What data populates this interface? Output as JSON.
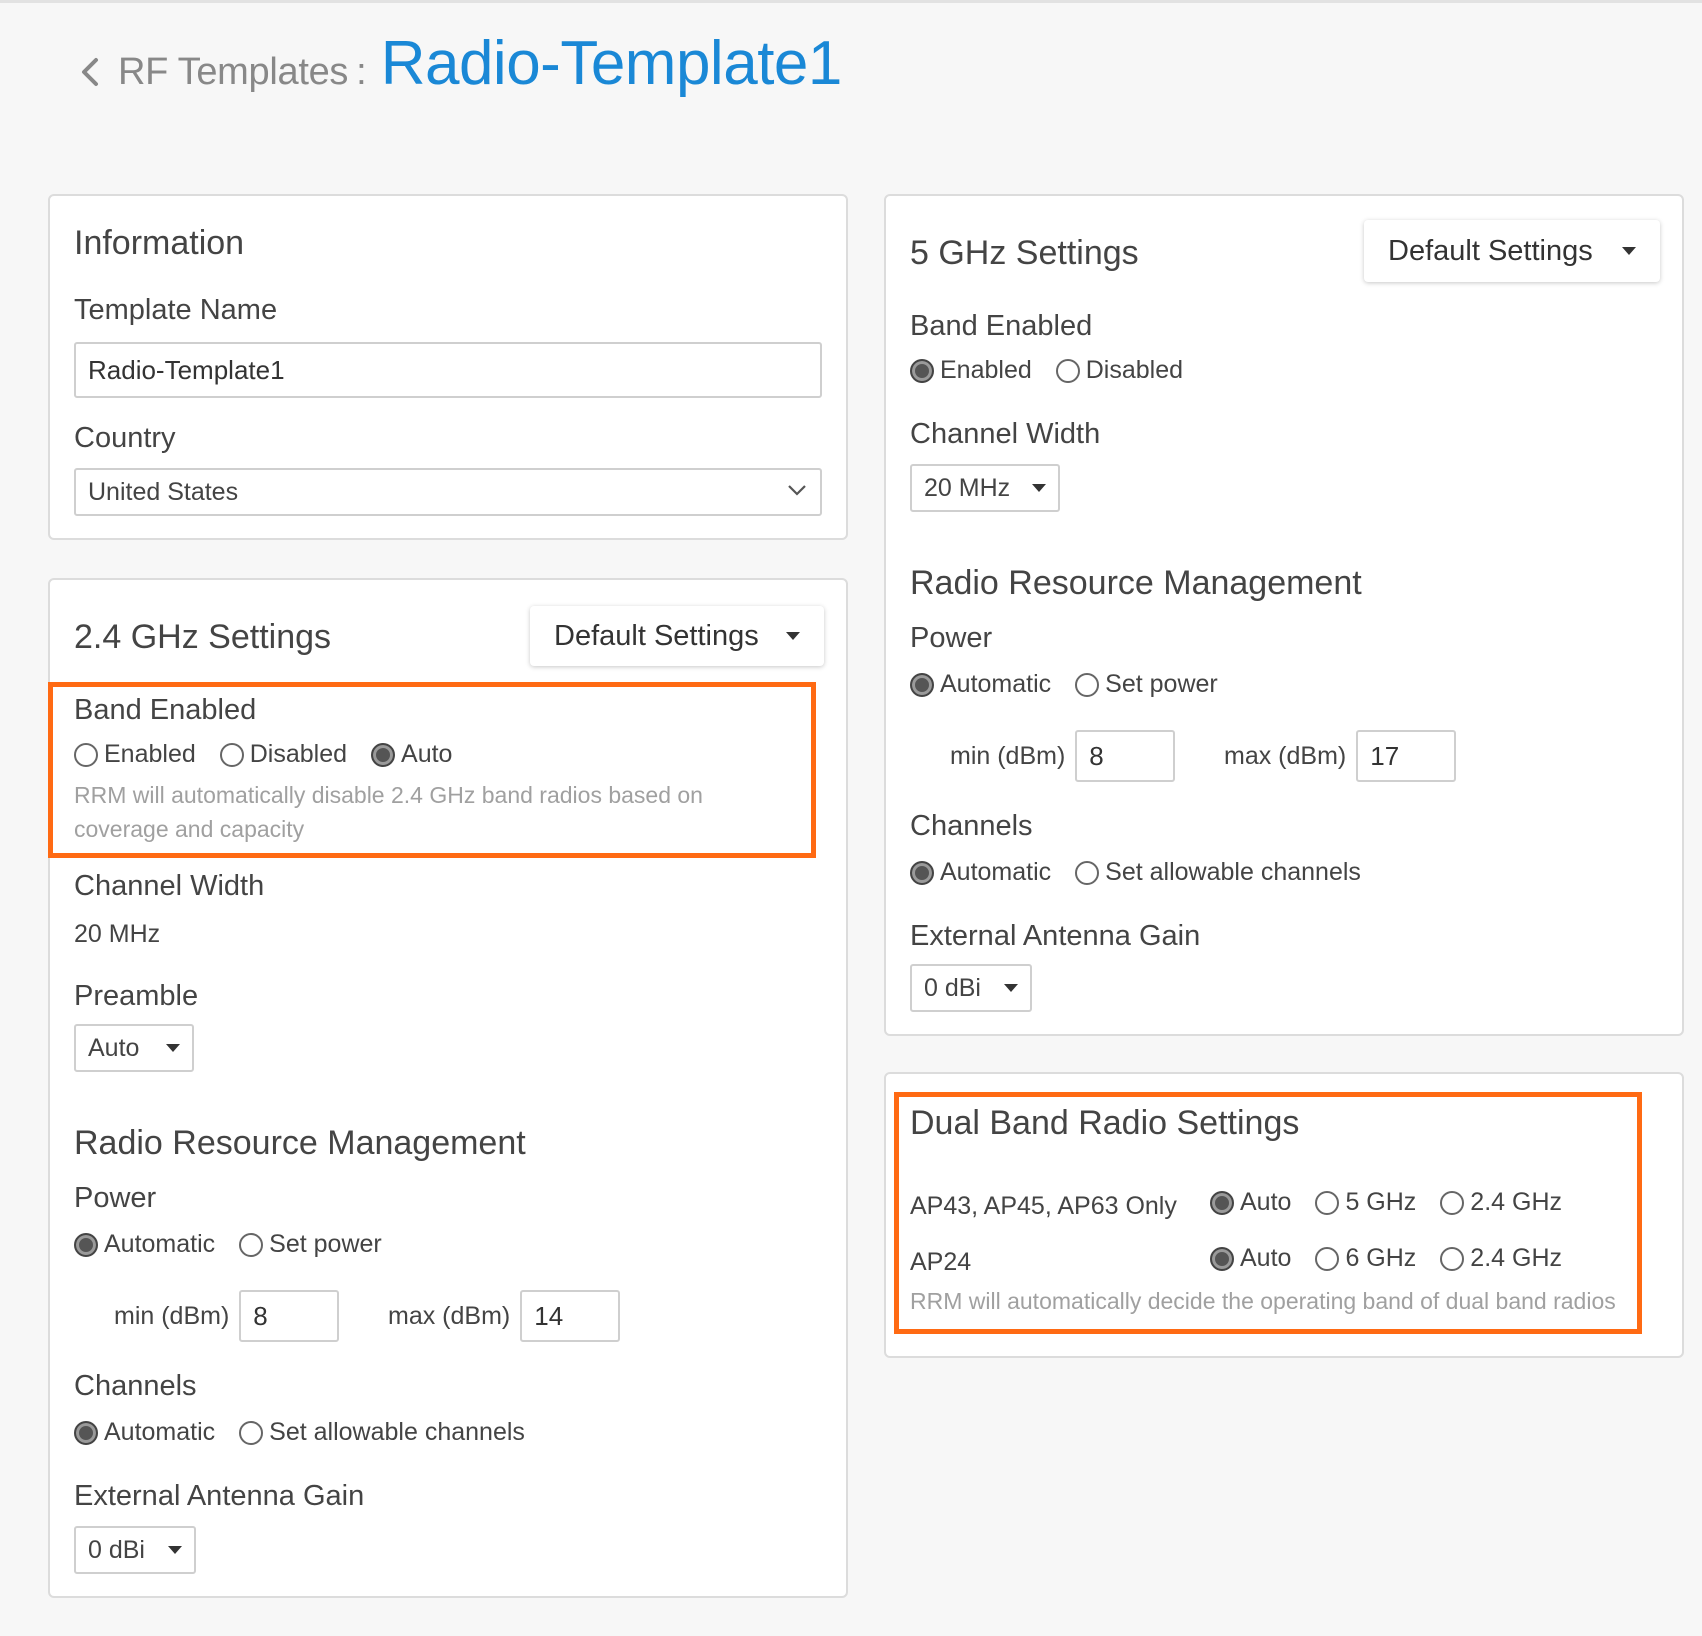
{
  "header": {
    "breadcrumb": "RF Templates",
    "separator": ":",
    "title": "Radio-Template1"
  },
  "colors": {
    "accent": "#1a88d6",
    "highlight": "#ff6a13"
  },
  "information": {
    "title": "Information",
    "template_name_label": "Template Name",
    "template_name_value": "Radio-Template1",
    "country_label": "Country",
    "country_value": "United States"
  },
  "band24": {
    "title": "2.4 GHz Settings",
    "settings_dropdown": "Default Settings",
    "band_enabled_label": "Band Enabled",
    "band_options": [
      "Enabled",
      "Disabled",
      "Auto"
    ],
    "band_selected": "Auto",
    "band_helper": "RRM will automatically disable 2.4 GHz band radios based on coverage and capacity",
    "channel_width_label": "Channel Width",
    "channel_width_value": "20 MHz",
    "preamble_label": "Preamble",
    "preamble_value": "Auto",
    "rrm_title": "Radio Resource Management",
    "power_label": "Power",
    "power_options": [
      "Automatic",
      "Set power"
    ],
    "power_selected": "Automatic",
    "min_label": "min (dBm)",
    "min_value": "8",
    "max_label": "max (dBm)",
    "max_value": "14",
    "channels_label": "Channels",
    "channels_options": [
      "Automatic",
      "Set allowable channels"
    ],
    "channels_selected": "Automatic",
    "antenna_label": "External Antenna Gain",
    "antenna_value": "0 dBi"
  },
  "band5": {
    "title": "5 GHz Settings",
    "settings_dropdown": "Default Settings",
    "band_enabled_label": "Band Enabled",
    "band_options": [
      "Enabled",
      "Disabled"
    ],
    "band_selected": "Enabled",
    "channel_width_label": "Channel Width",
    "channel_width_value": "20 MHz",
    "rrm_title": "Radio Resource Management",
    "power_label": "Power",
    "power_options": [
      "Automatic",
      "Set power"
    ],
    "power_selected": "Automatic",
    "min_label": "min (dBm)",
    "min_value": "8",
    "max_label": "max (dBm)",
    "max_value": "17",
    "channels_label": "Channels",
    "channels_options": [
      "Automatic",
      "Set allowable channels"
    ],
    "channels_selected": "Automatic",
    "antenna_label": "External Antenna Gain",
    "antenna_value": "0 dBi"
  },
  "dual_band": {
    "title": "Dual Band Radio Settings",
    "rows": [
      {
        "label": "AP43, AP45, AP63 Only",
        "options": [
          "Auto",
          "5 GHz",
          "2.4 GHz"
        ],
        "selected": "Auto"
      },
      {
        "label": "AP24",
        "options": [
          "Auto",
          "6 GHz",
          "2.4 GHz"
        ],
        "selected": "Auto"
      }
    ],
    "helper": "RRM will automatically decide the operating band of dual band radios"
  }
}
